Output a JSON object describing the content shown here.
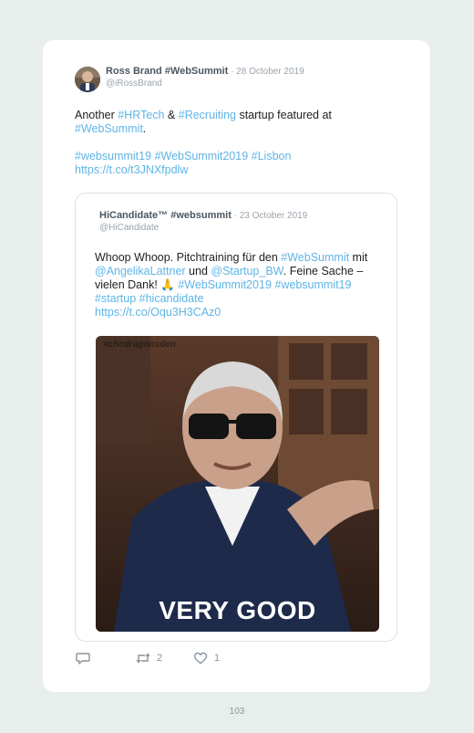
{
  "tweet": {
    "author": {
      "name": "Ross Brand #WebSummit",
      "separator": " · ",
      "date": "28 October 2019",
      "handle": "@iRossBrand"
    },
    "text": {
      "p1_a": "Another ",
      "p1_link1": "#HRTech",
      "p1_b": " & ",
      "p1_link2": "#Recruiting",
      "p1_c": " startup featured at ",
      "p1_link3": "#WebSummit",
      "p1_d": ".",
      "p2_link1": "#websummit19",
      "p2_link2": "#WebSummit2019",
      "p2_link3": "#Lisbon",
      "p2_url": "https://t.co/t3JNXfpdlw"
    },
    "actions": {
      "reply_icon": "reply-icon",
      "retweet_icon": "retweet-icon",
      "retweet_count": "2",
      "like_icon": "heart-icon",
      "like_count": "1"
    }
  },
  "quoted_tweet": {
    "author": {
      "name": "HiCandidate™ #websummit",
      "separator": " · ",
      "date": "23 October 2019",
      "handle": "@HiCandidate"
    },
    "text": {
      "a": "Whoop Whoop. Pitchtraining für den ",
      "link1": "#WebSummit",
      "b": " mit ",
      "link2": "@AngelikaLattner",
      "c": " und ",
      "link3": "@Startup_BW",
      "d": ". Feine Sache – vielen Dank! 🙏 ",
      "link4": "#WebSummit2019",
      "link5": "#websummit19",
      "link6": "#startup",
      "link7": "#hicandidate",
      "url": "https://t.co/Oqu3H3CAz0"
    },
    "media": {
      "watermark": "#chcdragonsden",
      "caption": "VERY GOOD"
    }
  },
  "page_number": "103",
  "colors": {
    "background": "#e8eeeb",
    "card": "#ffffff",
    "link": "#5fb4e6",
    "muted": "#9aa3ab"
  }
}
